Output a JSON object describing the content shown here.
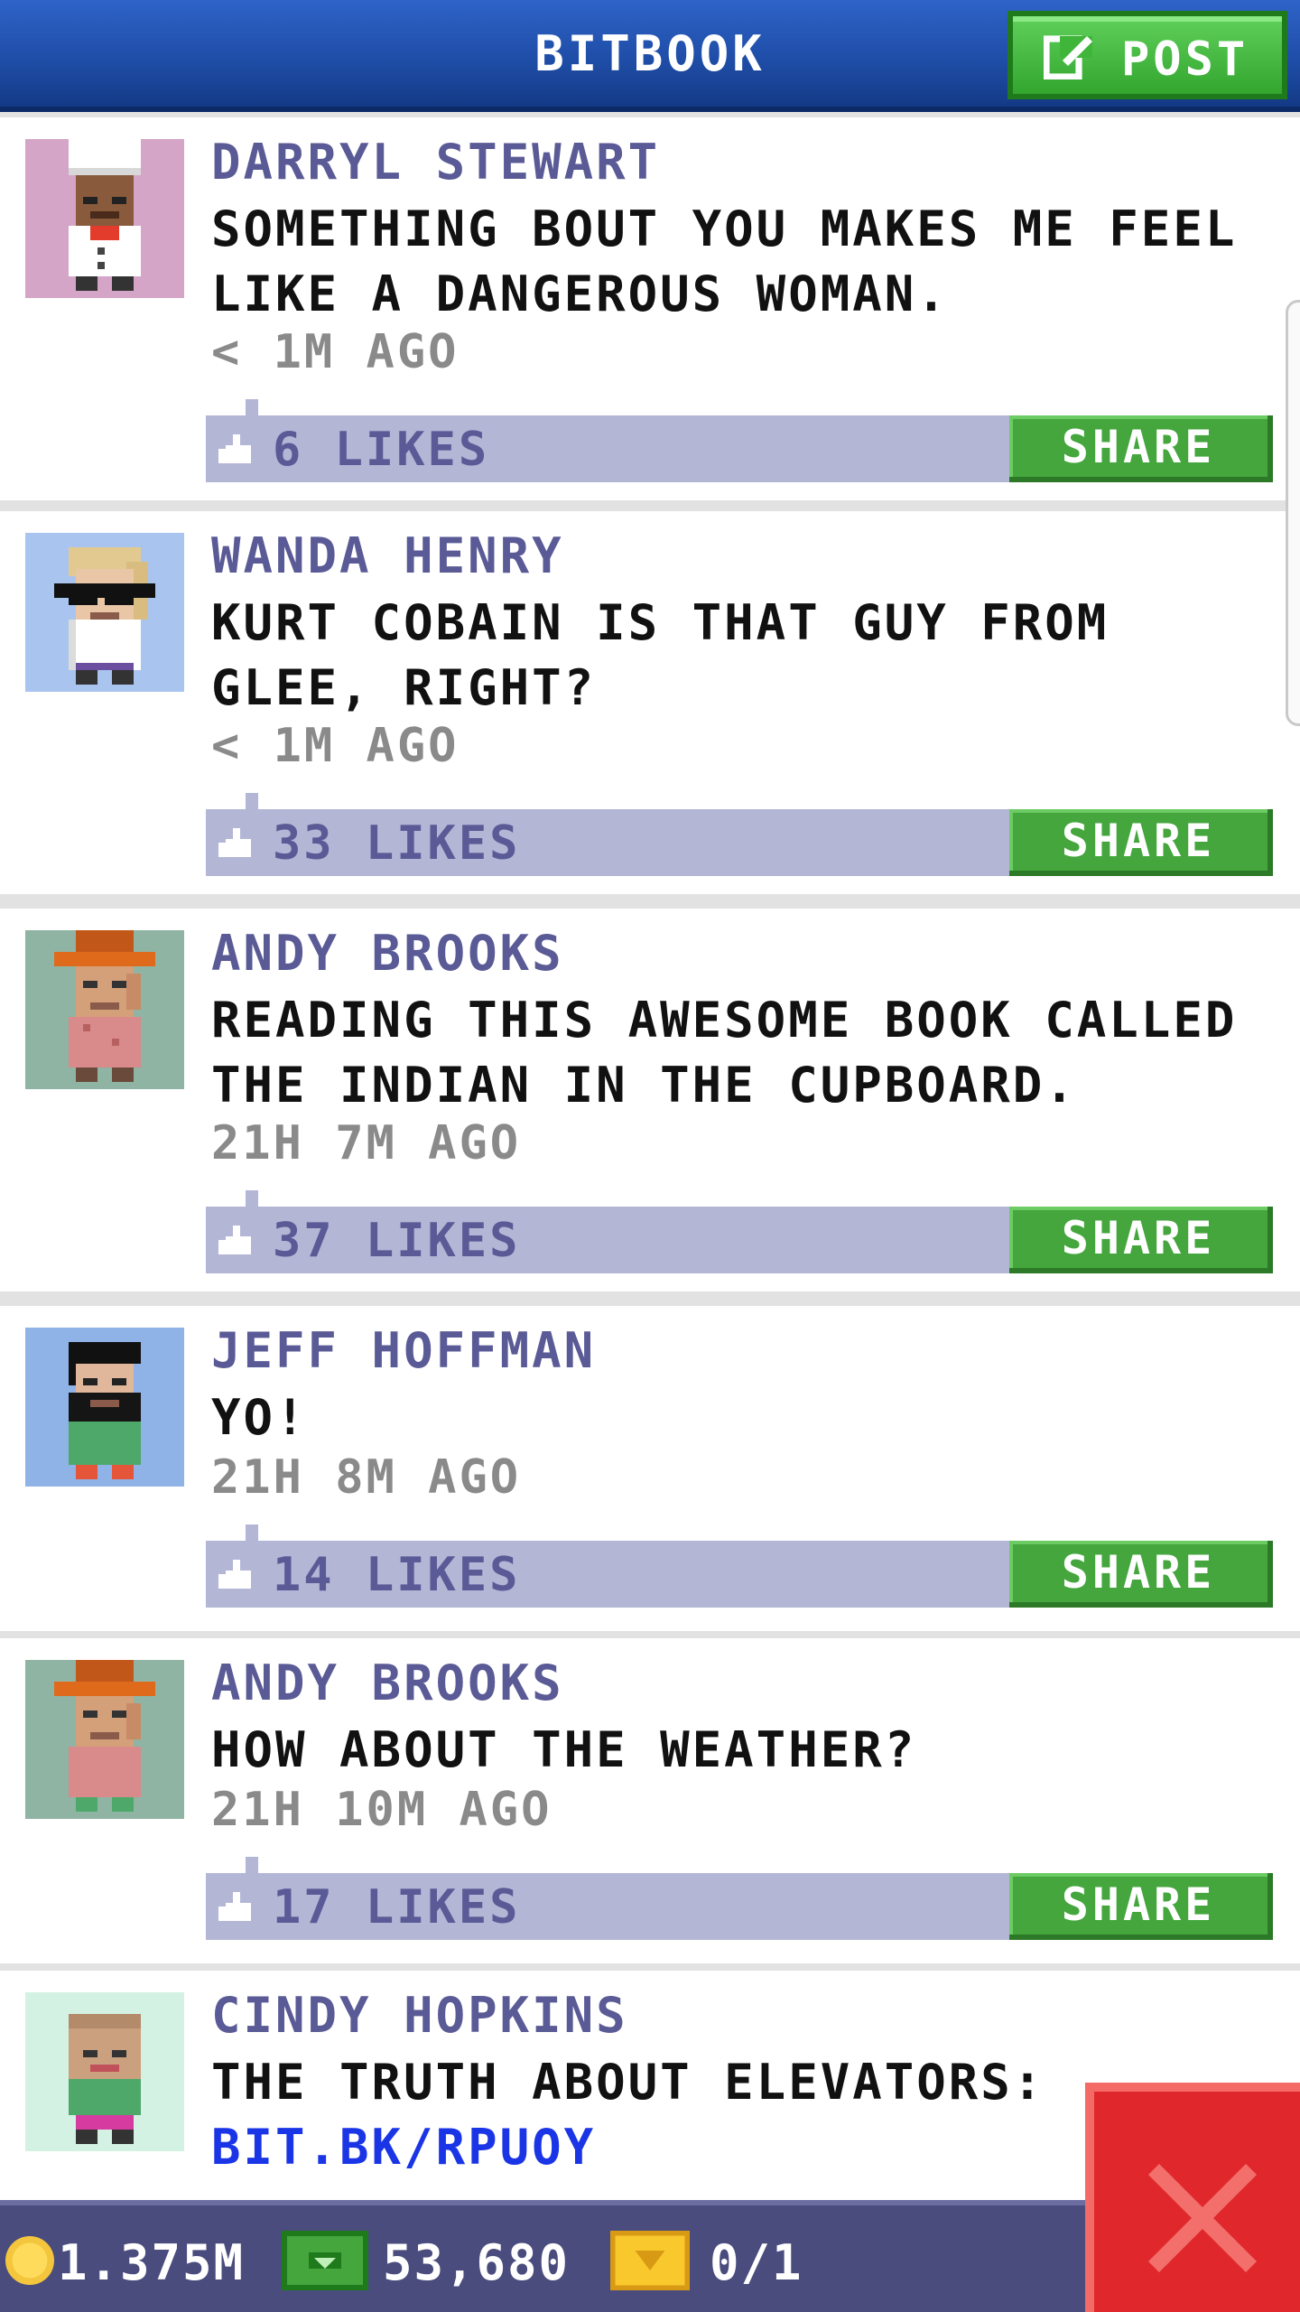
{
  "header": {
    "title": "BITBOOK",
    "post_label": "POST"
  },
  "posts": [
    {
      "author": "DARRYL STEWART",
      "message": "SOMETHING BOUT YOU MAKES ME FEEL LIKE A DANGEROUS WOMAN.",
      "time": "< 1M AGO",
      "likes": "6 LIKES",
      "share_label": "SHARE",
      "avatar_bg": "#d4a5c7",
      "avatar_icon": "chef-avatar-icon"
    },
    {
      "author": "WANDA HENRY",
      "message": "KURT COBAIN IS THAT GUY FROM GLEE, RIGHT?",
      "time": "< 1M AGO",
      "likes": "33 LIKES",
      "share_label": "SHARE",
      "avatar_bg": "#a9c4ef",
      "avatar_icon": "sunglasses-avatar-icon"
    },
    {
      "author": "ANDY BROOKS",
      "message": "READING THIS AWESOME BOOK CALLED THE INDIAN IN THE CUPBOARD.",
      "time": "21H 7M AGO",
      "likes": "37 LIKES",
      "share_label": "SHARE",
      "avatar_bg": "#8fb4a3",
      "avatar_icon": "orange-hat-avatar-icon"
    },
    {
      "author": "JEFF HOFFMAN",
      "message": "YO!",
      "time": "21H 8M AGO",
      "likes": "14 LIKES",
      "share_label": "SHARE",
      "avatar_bg": "#8fb3e6",
      "avatar_icon": "bearded-avatar-icon"
    },
    {
      "author": "ANDY BROOKS",
      "message": "HOW ABOUT THE WEATHER?",
      "time": "21H 10M AGO",
      "likes": "17 LIKES",
      "share_label": "SHARE",
      "avatar_bg": "#8fb4a3",
      "avatar_icon": "orange-hat-avatar-icon"
    },
    {
      "author": "CINDY HOPKINS",
      "message": "THE TRUTH ABOUT ELEVATORS:",
      "link": "BIT.BK/RPUOY",
      "avatar_bg": "#d4f2e4",
      "avatar_icon": "cindy-avatar-icon"
    }
  ],
  "status_bar": {
    "coins": "1.375M",
    "bux": "53,680",
    "tickets": "0/1"
  },
  "colors": {
    "header_blue": "#1f4ea8",
    "share_green": "#44a63d",
    "like_bar": "#b4b6d6",
    "author_purple": "#5a5a96",
    "close_red": "#e0282c"
  }
}
